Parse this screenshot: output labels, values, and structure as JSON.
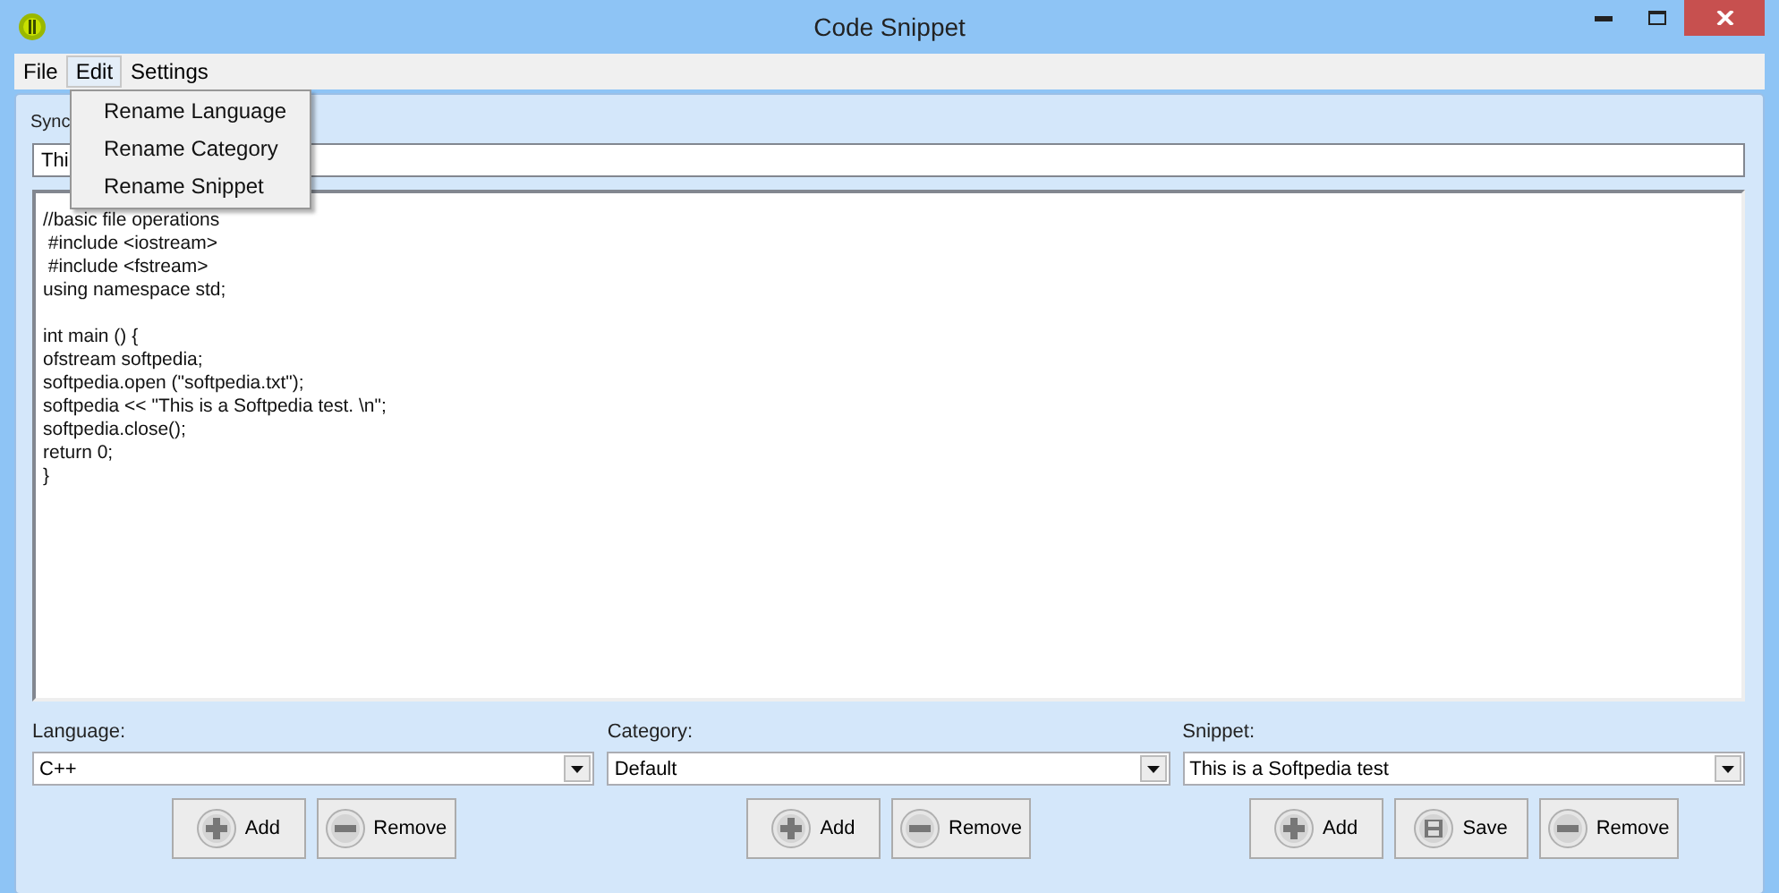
{
  "window": {
    "title": "Code Snippet"
  },
  "menu_bar": [
    {
      "label": "File",
      "selected": false
    },
    {
      "label": "Edit",
      "selected": true
    },
    {
      "label": "Settings",
      "selected": false
    }
  ],
  "open_menu": {
    "items": [
      "Rename Language",
      "Rename Category",
      "Rename Snippet"
    ]
  },
  "synopsis": {
    "label": "Sync",
    "value": "Thi"
  },
  "code": "//basic file operations\n #include <iostream>\n #include <fstream>\nusing namespace std;\n\nint main () {\nofstream softpedia;\nsoftpedia.open (\"softpedia.txt\");\nsoftpedia << \"This is a Softpedia test. \\n\";\nsoftpedia.close();\nreturn 0;\n}",
  "columns": [
    {
      "label": "Language:",
      "value": "C++",
      "buttons": [
        {
          "kind": "add",
          "label": "Add"
        },
        {
          "kind": "remove",
          "label": "Remove"
        }
      ]
    },
    {
      "label": "Category:",
      "value": "Default",
      "buttons": [
        {
          "kind": "add",
          "label": "Add"
        },
        {
          "kind": "remove",
          "label": "Remove"
        }
      ]
    },
    {
      "label": "Snippet:",
      "value": "This is a Softpedia test",
      "buttons": [
        {
          "kind": "add",
          "label": "Add"
        },
        {
          "kind": "save",
          "label": "Save"
        },
        {
          "kind": "remove",
          "label": "Remove"
        }
      ]
    }
  ]
}
